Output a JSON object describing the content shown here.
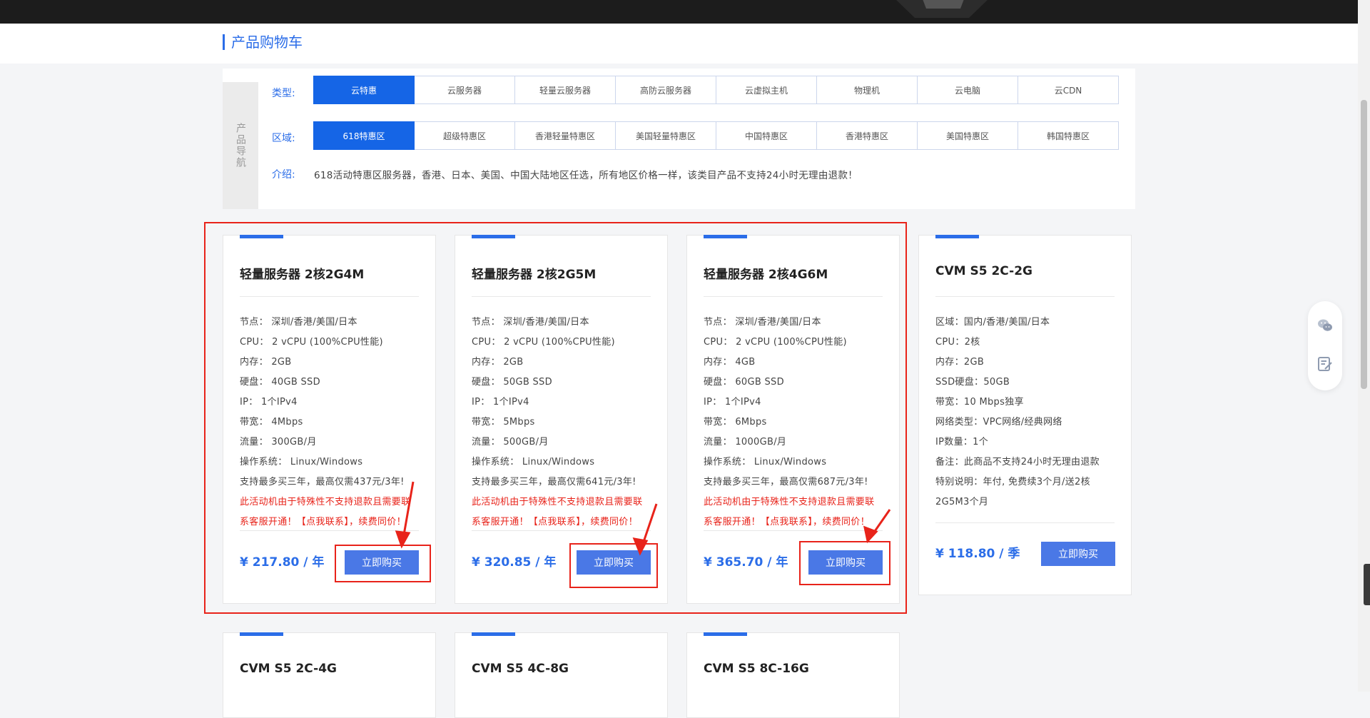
{
  "page": {
    "title": "产品购物车"
  },
  "nav": {
    "side_label": "产品导航",
    "type_label": "类型:",
    "region_label": "区域:",
    "intro_label": "介绍:",
    "types": [
      "云特惠",
      "云服务器",
      "轻量云服务器",
      "高防云服务器",
      "云虚拟主机",
      "物理机",
      "云电脑",
      "云CDN"
    ],
    "regions": [
      "618特惠区",
      "超级特惠区",
      "香港轻量特惠区",
      "美国轻量特惠区",
      "中国特惠区",
      "香港特惠区",
      "美国特惠区",
      "韩国特惠区"
    ],
    "active_type_index": 0,
    "active_region_index": 0,
    "intro": "618活动特惠区服务器，香港、日本、美国、中国大陆地区任选，所有地区价格一样，该类目产品不支持24小时无理由退款！"
  },
  "cards": [
    {
      "name": "轻量服务器 2核2G4M",
      "specs": [
        "节点：  深圳/香港/美国/日本",
        "CPU：  2 vCPU (100%CPU性能)",
        "内存：  2GB",
        "硬盘：  40GB SSD",
        "IP：  1个IPv4",
        "带宽：  4Mbps",
        "流量：  300GB/月",
        "操作系统：  Linux/Windows",
        "支持最多买三年，最高仅需437元/3年!"
      ],
      "warning": [
        "此活动机由于特殊性不支持退款且需要联",
        "系客服开通！【点我联系】，续费同价！"
      ],
      "price": "¥ 217.80 / 年",
      "buy": "立即购买"
    },
    {
      "name": "轻量服务器 2核2G5M",
      "specs": [
        "节点：  深圳/香港/美国/日本",
        "CPU：  2 vCPU (100%CPU性能)",
        "内存：  2GB",
        "硬盘：  50GB SSD",
        "IP：  1个IPv4",
        "带宽：  5Mbps",
        "流量：  500GB/月",
        "操作系统：  Linux/Windows",
        "支持最多买三年，最高仅需641元/3年!"
      ],
      "warning": [
        "此活动机由于特殊性不支持退款且需要联",
        "系客服开通！【点我联系】，续费同价！"
      ],
      "price": "¥ 320.85 / 年",
      "buy": "立即购买"
    },
    {
      "name": "轻量服务器 2核4G6M",
      "specs": [
        "节点：  深圳/香港/美国/日本",
        "CPU：  2 vCPU (100%CPU性能)",
        "内存：  4GB",
        "硬盘：  60GB SSD",
        "IP：  1个IPv4",
        "带宽：  6Mbps",
        "流量：  1000GB/月",
        "操作系统：  Linux/Windows",
        "支持最多买三年，最高仅需687元/3年!"
      ],
      "warning": [
        "此活动机由于特殊性不支持退款且需要联",
        "系客服开通！【点我联系】，续费同价！"
      ],
      "price": "¥ 365.70 / 年",
      "buy": "立即购买"
    },
    {
      "name": "CVM S5 2C-2G",
      "specs": [
        "区域：国内/香港/美国/日本",
        "CPU：2核",
        "内存：2GB",
        "SSD硬盘：50GB",
        "带宽：10 Mbps独享",
        "网络类型：VPC网络/经典网络",
        "IP数量：1个",
        "备注：此商品不支持24小时无理由退款",
        "特别说明：年付, 免费续3个月/送2核",
        "2G5M3个月"
      ],
      "warning": [],
      "price": "¥ 118.80 / 季",
      "buy": "立即购买"
    },
    {
      "name": "CVM S5 2C-4G"
    },
    {
      "name": "CVM S5 4C-8G"
    },
    {
      "name": "CVM S5 8C-16G"
    }
  ],
  "float_icons": [
    "wechat-icon",
    "note-edit-icon"
  ],
  "colors": {
    "accent": "#2b6de8",
    "active_tab": "#1565e6",
    "buy_button": "#4a78e6",
    "warning_text": "#e8231a",
    "annotation_red": "#e8231a"
  }
}
